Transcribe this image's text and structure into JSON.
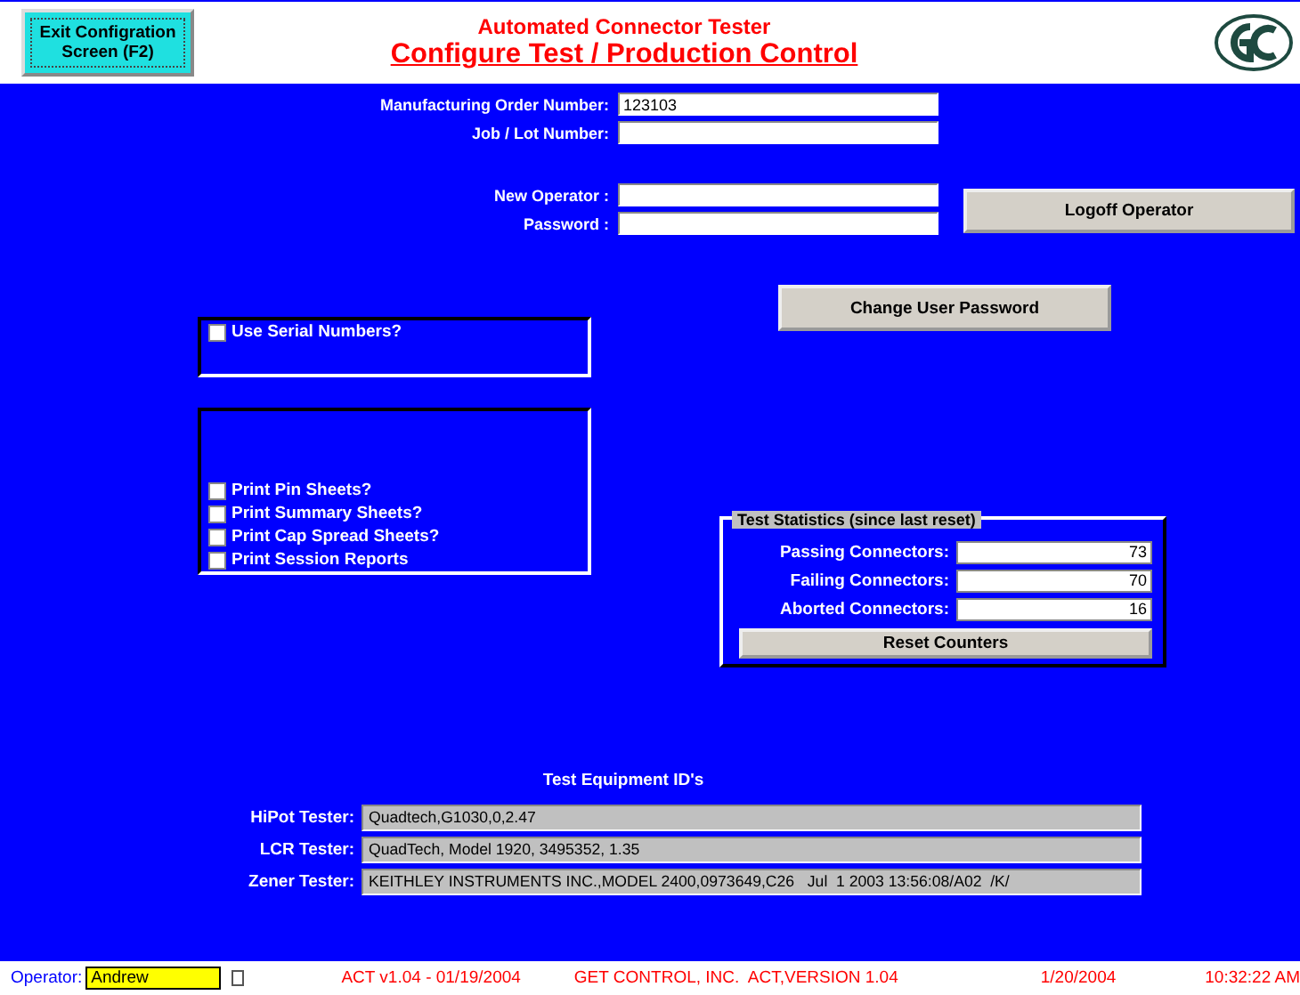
{
  "header": {
    "exit_button": {
      "line1": "Exit Configration",
      "line2": "Screen  (F2)"
    },
    "subtitle": "Automated Connector Tester",
    "title": "Configure Test / Production Control"
  },
  "order_fields": [
    {
      "label": "Manufacturing Order Number:",
      "value": "123103"
    },
    {
      "label": "Job / Lot Number:"
    }
  ],
  "operator_fields": [
    {
      "label": "New Operator :"
    },
    {
      "label": "Password :"
    }
  ],
  "logoff_button": "Logoff Operator",
  "change_password_button": "Change User Password",
  "serial_options": [
    {
      "label": "Use Serial Numbers?",
      "checked": false
    }
  ],
  "print_options": [
    {
      "label": "Print Pin Sheets?",
      "checked": false
    },
    {
      "label": "Print Summary Sheets?",
      "checked": false
    },
    {
      "label": "Print Cap Spread Sheets?",
      "checked": false
    },
    {
      "label": "Print Session Reports",
      "checked": false
    }
  ],
  "test_statistics": {
    "title": "Test Statistics (since last reset)",
    "rows": [
      {
        "label": "Passing Connectors:",
        "value": "73"
      },
      {
        "label": "Failing Connectors:",
        "value": "70"
      },
      {
        "label": "Aborted Connectors:",
        "value": "16"
      }
    ],
    "reset_button": "Reset Counters"
  },
  "equipment": {
    "title": "Test Equipment ID's",
    "rows": [
      {
        "label": "HiPot Tester:",
        "value": "Quadtech,G1030,0,2.47"
      },
      {
        "label": "LCR Tester:",
        "value": "QuadTech, Model 1920, 3495352, 1.35"
      },
      {
        "label": "Zener Tester:",
        "value": "KEITHLEY INSTRUMENTS INC.,MODEL 2400,0973649,C26   Jul  1 2003 13:56:08/A02  /K/"
      }
    ]
  },
  "status_bar": {
    "operator_label": "Operator:",
    "operator_value": "Andrew",
    "checkbox_checked": false,
    "items": [
      "ACT v1.04 - 01/19/2004",
      "GET CONTROL, INC.  ACT,VERSION 1.04",
      "1/20/2004",
      "10:32:22 AM"
    ]
  }
}
